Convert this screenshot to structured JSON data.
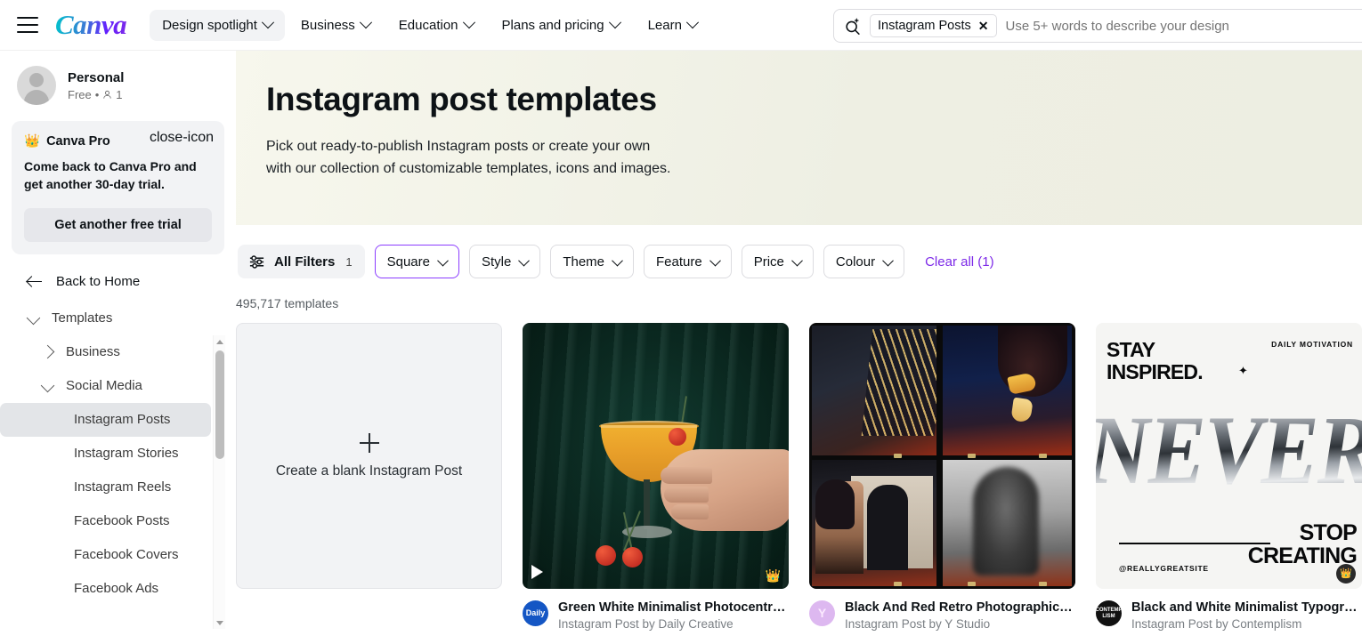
{
  "topbar": {
    "menu_icon": "hamburger-icon",
    "brand": "Canva",
    "nav": [
      {
        "label": "Design spotlight",
        "active": true
      },
      {
        "label": "Business",
        "active": false
      },
      {
        "label": "Education",
        "active": false
      },
      {
        "label": "Plans and pricing",
        "active": false
      },
      {
        "label": "Learn",
        "active": false
      }
    ],
    "search": {
      "icon": "magic-search-icon",
      "chip": "Instagram Posts",
      "chip_remove": "✕",
      "placeholder": "Use 5+ words to describe your design",
      "value": ""
    }
  },
  "sidebar": {
    "account": {
      "name": "Personal",
      "plan": "Free",
      "separator": "•",
      "members_icon": "person-icon",
      "members": "1"
    },
    "pro_card": {
      "crown_icon": "crown-icon",
      "title": "Canva Pro",
      "close_icon": "close-icon",
      "body": "Come back to Canva Pro and get another 30-day trial.",
      "button": "Get another free trial"
    },
    "back_home": {
      "icon": "arrow-left-icon",
      "label": "Back to Home"
    },
    "tree": [
      {
        "label": "Templates",
        "level": 0,
        "state": "expanded",
        "selected": false
      },
      {
        "label": "Business",
        "level": 1,
        "state": "collapsed",
        "selected": false
      },
      {
        "label": "Social Media",
        "level": 1,
        "state": "expanded",
        "selected": false
      },
      {
        "label": "Instagram Posts",
        "level": 2,
        "state": "leaf",
        "selected": true
      },
      {
        "label": "Instagram Stories",
        "level": 2,
        "state": "leaf",
        "selected": false
      },
      {
        "label": "Instagram Reels",
        "level": 2,
        "state": "leaf",
        "selected": false
      },
      {
        "label": "Facebook Posts",
        "level": 2,
        "state": "leaf",
        "selected": false
      },
      {
        "label": "Facebook Covers",
        "level": 2,
        "state": "leaf",
        "selected": false
      },
      {
        "label": "Facebook Ads",
        "level": 2,
        "state": "leaf",
        "selected": false
      }
    ]
  },
  "hero": {
    "title": "Instagram post templates",
    "subtitle_line1": "Pick out ready-to-publish Instagram posts or create your own",
    "subtitle_line2": "with our collection of customizable templates, icons and images."
  },
  "filters": {
    "all_filters_icon": "sliders-icon",
    "all_filters_label": "All Filters",
    "all_filters_count": "1",
    "buttons": [
      {
        "label": "Square",
        "active": true
      },
      {
        "label": "Style",
        "active": false
      },
      {
        "label": "Theme",
        "active": false
      },
      {
        "label": "Feature",
        "active": false
      },
      {
        "label": "Price",
        "active": false
      },
      {
        "label": "Colour",
        "active": false
      }
    ],
    "clear_all": "Clear all (1)",
    "clear_all_color": "#7d2ae8",
    "active_border_color": "#8b3dff",
    "results_count": "495,717 templates"
  },
  "blank_card": {
    "plus_icon": "plus-icon",
    "label": "Create a blank Instagram Post"
  },
  "cards": [
    {
      "title": "Green White Minimalist Photocentri…",
      "subtitle": "Instagram Post by Daily Creative",
      "avatar_text": "Daily",
      "avatar_bg": "#1456c4",
      "avatar_fg": "#ffffff",
      "badges": {
        "play": true,
        "crown": true
      },
      "crown_icon": "crown-icon",
      "play_icon": "play-icon"
    },
    {
      "title": "Black And Red Retro Photographic Fi…",
      "subtitle": "Instagram Post by Y Studio",
      "avatar_text": "Y",
      "avatar_bg": "#ddb8f0",
      "avatar_fg": "#fbe9ff",
      "badges": {
        "play": false,
        "crown": false
      },
      "crown_icon": "crown-icon",
      "play_icon": "play-icon"
    },
    {
      "title": "Black and White Minimalist Typogra…",
      "subtitle": "Instagram Post by Contemplism",
      "avatar_text": "CONTEMP LISM",
      "avatar_bg": "#111111",
      "avatar_fg": "#ffffff",
      "badges": {
        "play": false,
        "crown": true
      },
      "crown_icon": "crown-icon",
      "play_icon": "play-icon"
    }
  ],
  "thumb3_text": {
    "headline_line1": "STAY",
    "headline_line2": "INSPIRED.",
    "tag": "DAILY MOTIVATION",
    "sparkle": "✦",
    "chrome_word": "NEVER",
    "handle": "@REALLYGREATSITE",
    "stop_line1": "STOP",
    "stop_line2": "CREATING"
  }
}
